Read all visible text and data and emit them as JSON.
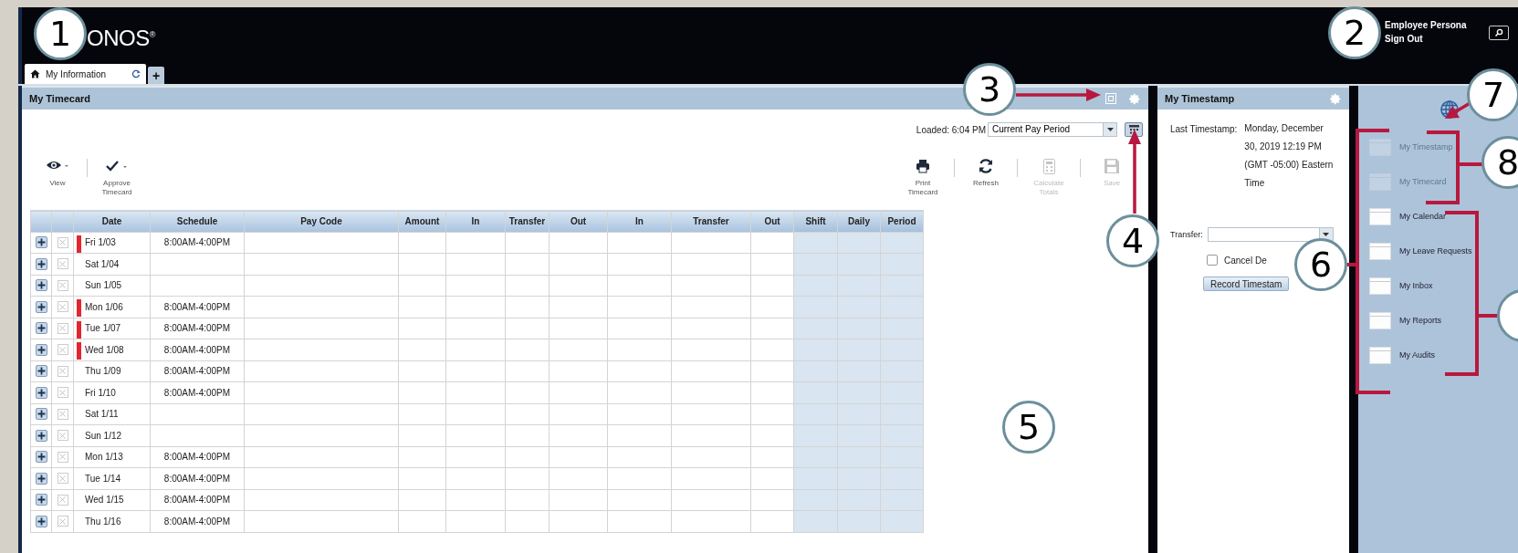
{
  "header": {
    "logo": "ONOS$^{®}$",
    "user_name": "Employee Persona",
    "sign_out": "Sign Out"
  },
  "tabs": [
    {
      "label": "My Information",
      "selected": true
    }
  ],
  "add_tab": "+",
  "timecard": {
    "title": "My Timecard",
    "loaded": "Loaded: 6:04 PM",
    "period": "Current Pay Period",
    "actions_left": [
      {
        "label": "View",
        "disabled": false
      },
      {
        "label": "Approve Timecard",
        "disabled": false
      }
    ],
    "actions_right": [
      {
        "label": "Print Timecard",
        "disabled": false
      },
      {
        "label": "Refresh",
        "disabled": false
      },
      {
        "label": "Calculate Totals",
        "disabled": true
      },
      {
        "label": "Save",
        "disabled": true
      }
    ],
    "columns": [
      {
        "label": "Date",
        "kind": "entry"
      },
      {
        "label": "Schedule",
        "kind": "entry"
      },
      {
        "label": "Pay Code",
        "kind": "entry"
      },
      {
        "label": "Amount",
        "kind": "entry"
      },
      {
        "label": "In",
        "kind": "entry"
      },
      {
        "label": "Transfer",
        "kind": "entry"
      },
      {
        "label": "Out",
        "kind": "entry"
      },
      {
        "label": "In",
        "kind": "entry"
      },
      {
        "label": "Transfer",
        "kind": "entry"
      },
      {
        "label": "Out",
        "kind": "entry"
      },
      {
        "label": "Shift",
        "kind": "total"
      },
      {
        "label": "Daily",
        "kind": "total"
      },
      {
        "label": "Period",
        "kind": "total"
      }
    ],
    "rows": [
      {
        "date": "Fri 1/03",
        "schedule": "8:00AM-4:00PM",
        "flagged": true
      },
      {
        "date": "Sat 1/04",
        "flagged": false
      },
      {
        "date": "Sun 1/05",
        "flagged": false
      },
      {
        "date": "Mon 1/06",
        "schedule": "8:00AM-4:00PM",
        "flagged": true
      },
      {
        "date": "Tue 1/07",
        "schedule": "8:00AM-4:00PM",
        "flagged": true
      },
      {
        "date": "Wed 1/08",
        "schedule": "8:00AM-4:00PM",
        "flagged": true
      },
      {
        "date": "Thu 1/09",
        "schedule": "8:00AM-4:00PM",
        "flagged": false
      },
      {
        "date": "Fri 1/10",
        "schedule": "8:00AM-4:00PM",
        "flagged": false
      },
      {
        "date": "Sat 1/11",
        "flagged": false
      },
      {
        "date": "Sun 1/12",
        "flagged": false
      },
      {
        "date": "Mon 1/13",
        "schedule": "8:00AM-4:00PM",
        "flagged": false
      },
      {
        "date": "Tue 1/14",
        "schedule": "8:00AM-4:00PM",
        "flagged": false
      },
      {
        "date": "Wed 1/15",
        "schedule": "8:00AM-4:00PM",
        "flagged": false
      },
      {
        "date": "Thu 1/16",
        "schedule": "8:00AM-4:00PM",
        "flagged": false
      }
    ]
  },
  "timestamp": {
    "title": "My Timestamp",
    "last_label": "Last Timestamp:",
    "last_value": "Monday, December 30, 2019 12:19 PM (GMT -05:00) Eastern Time",
    "transfer_label": "Transfer:",
    "cancel": {
      "label": "Cancel De",
      "checked": false
    },
    "record_button": "Record Timestam"
  },
  "sidebar": {
    "items": [
      {
        "label": "My Timestamp",
        "disabled": true
      },
      {
        "label": "My Timecard",
        "disabled": true
      },
      {
        "label": "My Calendar",
        "disabled": false
      },
      {
        "label": "My Leave Requests",
        "disabled": false
      },
      {
        "label": "My Inbox",
        "disabled": false
      },
      {
        "label": "My Reports",
        "disabled": false
      },
      {
        "label": "My Audits",
        "disabled": false
      }
    ]
  },
  "callouts": [
    "1",
    "2",
    "3",
    "4",
    "5",
    "6",
    "7",
    "8"
  ]
}
